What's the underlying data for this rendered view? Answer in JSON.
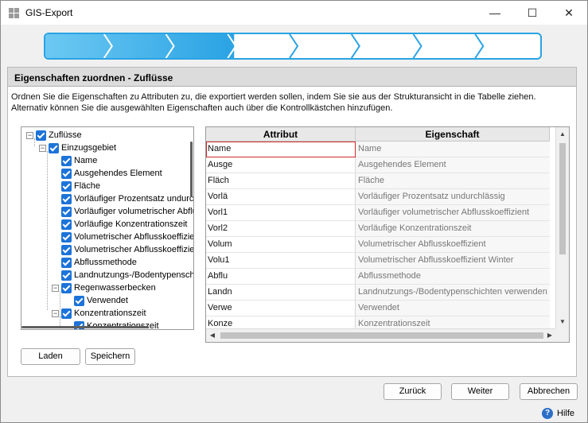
{
  "window": {
    "title": "GIS-Export",
    "minimize_glyph": "—",
    "maximize_glyph": "☐",
    "close_glyph": "✕"
  },
  "wizard": {
    "total_steps": 8,
    "completed_steps": 3,
    "accent": "#2aa3e4",
    "fill_start": "#6cc8f2",
    "fill_end": "#2aa3e4"
  },
  "section": {
    "title": "Eigenschaften zuordnen - Zuflüsse",
    "description": "Ordnen Sie die Eigenschaften zu Attributen zu, die exportiert werden sollen, indem Sie sie aus der Strukturansicht in die Tabelle ziehen. Alternativ können Sie die ausgewählten Eigenschaften auch über die Kontrollkästchen hinzufügen."
  },
  "tree": {
    "items": [
      {
        "label": "Zuflüsse",
        "level": 0,
        "expander": "⊟"
      },
      {
        "label": "Einzugsgebiet",
        "level": 1,
        "expander": "⊟"
      },
      {
        "label": "Name",
        "level": 2,
        "expander": ""
      },
      {
        "label": "Ausgehendes Element",
        "level": 2,
        "expander": ""
      },
      {
        "label": "Fläche",
        "level": 2,
        "expander": ""
      },
      {
        "label": "Vorläufiger Prozentsatz undurchlässig",
        "level": 2,
        "expander": ""
      },
      {
        "label": "Vorläufiger volumetrischer Abflusskoeffizient",
        "level": 2,
        "expander": ""
      },
      {
        "label": "Vorläufige Konzentrationszeit",
        "level": 2,
        "expander": ""
      },
      {
        "label": "Volumetrischer Abflusskoeffizient",
        "level": 2,
        "expander": ""
      },
      {
        "label": "Volumetrischer Abflusskoeffizient Winter",
        "level": 2,
        "expander": ""
      },
      {
        "label": "Abflussmethode",
        "level": 2,
        "expander": ""
      },
      {
        "label": "Landnutzungs-/Bodentypenschichten verwenden",
        "level": 2,
        "expander": ""
      },
      {
        "label": "Regenwasserbecken",
        "level": 2,
        "expander": "⊟"
      },
      {
        "label": "Verwendet",
        "level": 3,
        "expander": ""
      },
      {
        "label": "Konzentrationszeit",
        "level": 2,
        "expander": "⊟"
      },
      {
        "label": "Konzentrationszeit",
        "level": 3,
        "expander": ""
      }
    ]
  },
  "grid": {
    "columns": [
      "Attribut",
      "Eigenschaft"
    ],
    "rows": [
      {
        "attribut": "Name",
        "eigenschaft": "Name"
      },
      {
        "attribut": "Ausge",
        "eigenschaft": "Ausgehendes Element"
      },
      {
        "attribut": "Fläch",
        "eigenschaft": "Fläche"
      },
      {
        "attribut": "Vorlä",
        "eigenschaft": "Vorläufiger Prozentsatz undurchlässig"
      },
      {
        "attribut": "Vorl1",
        "eigenschaft": "Vorläufiger volumetrischer Abflusskoeffizient"
      },
      {
        "attribut": "Vorl2",
        "eigenschaft": "Vorläufige Konzentrationszeit"
      },
      {
        "attribut": "Volum",
        "eigenschaft": "Volumetrischer Abflusskoeffizient"
      },
      {
        "attribut": "Volu1",
        "eigenschaft": "Volumetrischer Abflusskoeffizient Winter"
      },
      {
        "attribut": "Abflu",
        "eigenschaft": "Abflussmethode"
      },
      {
        "attribut": "Landn",
        "eigenschaft": "Landnutzungs-/Bodentypenschichten verwenden"
      },
      {
        "attribut": "Verwe",
        "eigenschaft": "Verwendet"
      },
      {
        "attribut": "Konze",
        "eigenschaft": "Konzentrationszeit"
      }
    ],
    "selected_border_color": "#d02b2b"
  },
  "buttons": {
    "laden": "Laden",
    "speichern": "Speichern",
    "zurueck": "Zurück",
    "weiter": "Weiter",
    "abbrechen": "Abbrechen"
  },
  "help": {
    "icon": "help-icon",
    "label": "Hilfe"
  }
}
